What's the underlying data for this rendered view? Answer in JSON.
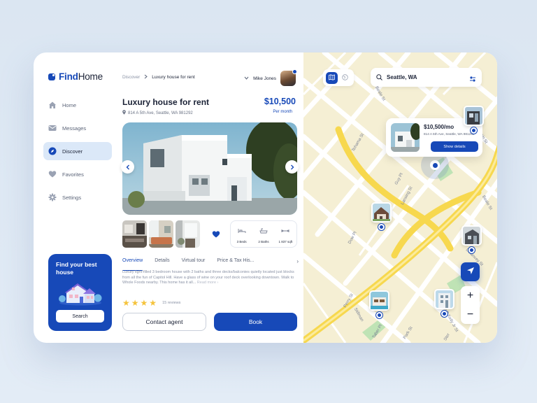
{
  "brand": {
    "find": "Find",
    "home": "Home"
  },
  "sidebar": {
    "items": [
      {
        "label": "Home",
        "icon": "home-icon",
        "active": false
      },
      {
        "label": "Messages",
        "icon": "mail-icon",
        "active": false
      },
      {
        "label": "Discover",
        "icon": "compass-icon",
        "active": true
      },
      {
        "label": "Favorites",
        "icon": "heart-icon",
        "active": false
      },
      {
        "label": "Settings",
        "icon": "gear-icon",
        "active": false
      }
    ],
    "promo": {
      "title": "Find your best house",
      "button": "Search"
    }
  },
  "breadcrumb": {
    "parent": "Discover",
    "current": "Luxury house for rent"
  },
  "user": {
    "name": "Mike Jones"
  },
  "listing": {
    "title": "Luxury house for rent",
    "address": "814 A 5th Ave, Seattle, WA 981292",
    "price": "$10,500",
    "period": "Per month",
    "specs": {
      "beds": "3 Beds",
      "baths": "2 Baths",
      "area": "1 837 sqft"
    },
    "tabs": [
      "Overview",
      "Details",
      "Virtual tour",
      "Price & Tax His..."
    ],
    "description": "Luxury light-filled 3 bedroom house with 2 baths and three decks/balconies quietly located just blocks from all the fun of Capitol Hill. Have a glass of wine on your roof deck overlooking downtown. Walk to Whole Foods nearby. This home has it all...",
    "read_more": "Read more",
    "rating": 4,
    "reviews": "15 reviews",
    "contact_label": "Contact agent",
    "book_label": "Book"
  },
  "map": {
    "search_value": "Seattle, WA",
    "popup": {
      "price": "$10,500/mo",
      "address": "814 A 5th Ave, Seattle, WA 981292",
      "button": "Show details"
    },
    "streets": {
      "beale_top": "Beale St",
      "tehama": "Tehama St",
      "main": "Main St",
      "guy": "Guy Pl",
      "lansing": "Lansing St",
      "beale_mid": "Beale St",
      "dow": "Dow Pl",
      "delancey": "Delancey St",
      "perry": "Perry St",
      "stillman": "Stillman",
      "taber": "Taber Pl",
      "park": "Park St",
      "colin": "Colin P Kelly Jr St",
      "ster": "Ster"
    }
  },
  "colors": {
    "accent": "#1749b8",
    "map_land": "#f5efd4",
    "highway": "#f7d84e",
    "park": "#bfe3b5",
    "star": "#f5c33b"
  }
}
